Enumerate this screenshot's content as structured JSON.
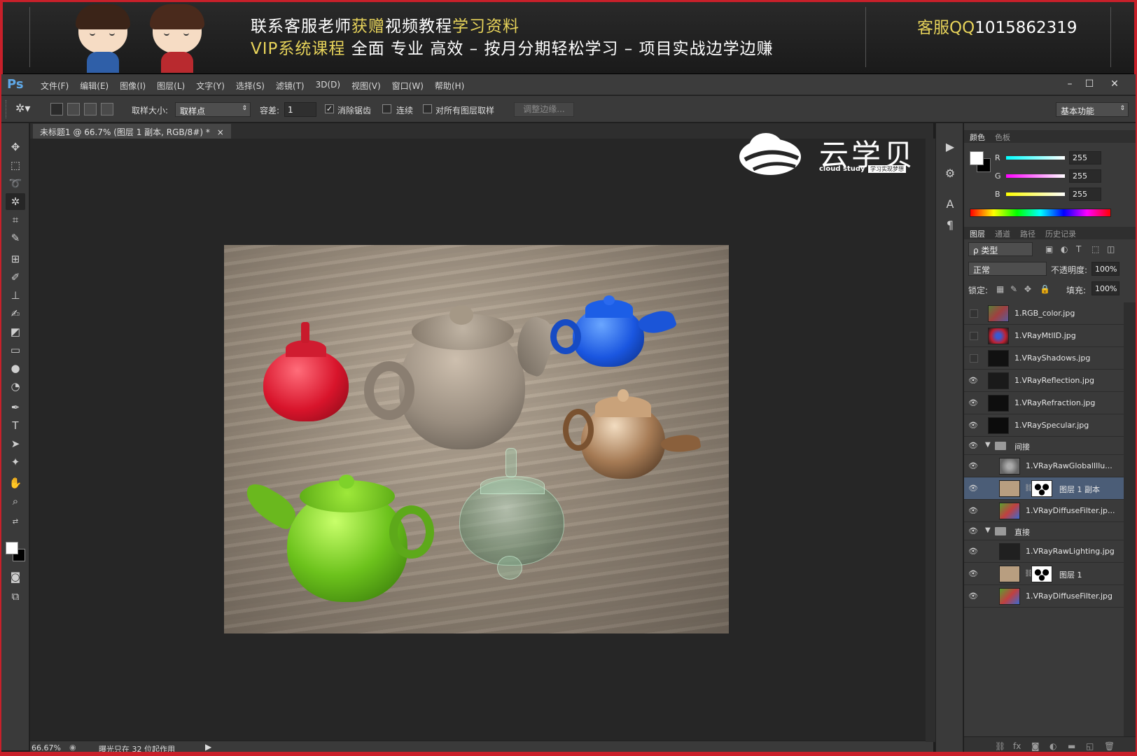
{
  "banner": {
    "line1_a": "联系客服老师",
    "line1_b": "获赠",
    "line1_c": "视频教程",
    "line1_d": "学习资料",
    "line2_a": "VIP系统课程",
    "line2_b": "   全面  专业  高效  –  按月分期轻松学习  –  项目实战边学边赚",
    "qq_label": "客服QQ",
    "qq_number": "1015862319"
  },
  "app": {
    "logo": "Ps",
    "menu": [
      "文件(F)",
      "编辑(E)",
      "图像(I)",
      "图层(L)",
      "文字(Y)",
      "选择(S)",
      "滤镜(T)",
      "3D(D)",
      "视图(V)",
      "窗口(W)",
      "帮助(H)"
    ],
    "window_controls": {
      "minimize": "–",
      "maximize": "☐",
      "close": "✕"
    }
  },
  "options": {
    "sample_size_label": "取样大小:",
    "sample_size_value": "取样点",
    "tolerance_label": "容差:",
    "tolerance_value": "1",
    "anti_alias_label": "消除锯齿",
    "anti_alias_checked": true,
    "contiguous_label": "连续",
    "contiguous_checked": false,
    "sample_all_label": "对所有图层取样",
    "sample_all_checked": false,
    "refine_edge_label": "调整边缘...",
    "workspace_value": "基本功能"
  },
  "document": {
    "tab_title": "未标题1 @ 66.7% (图层 1 副本, RGB/8#) *",
    "tab_close": "×",
    "watermark_text": "云学贝",
    "watermark_sub": "cloud study",
    "watermark_sub2": "学习实现梦想"
  },
  "status": {
    "zoom": "66.67%",
    "message": "曝光只在 32 位起作用",
    "arrow": "▶"
  },
  "color_panel": {
    "tabs": [
      "颜色",
      "色板"
    ],
    "r_label": "R",
    "r_value": "255",
    "g_label": "G",
    "g_value": "255",
    "b_label": "B",
    "b_value": "255"
  },
  "layers_panel": {
    "tabs": [
      "图层",
      "通道",
      "路径",
      "历史记录"
    ],
    "filter_value": "ρ 类型",
    "blend_mode": "正常",
    "opacity_label": "不透明度:",
    "opacity_value": "100%",
    "lock_label": "锁定:",
    "fill_label": "填充:",
    "fill_value": "100%",
    "layers": [
      {
        "name": "1.RGB_color.jpg",
        "visible": false
      },
      {
        "name": "1.VRayMtlID.jpg",
        "visible": false
      },
      {
        "name": "1.VRayShadows.jpg",
        "visible": false
      },
      {
        "name": "1.VRayReflection.jpg",
        "visible": true
      },
      {
        "name": "1.VRayRefraction.jpg",
        "visible": true
      },
      {
        "name": "1.VRaySpecular.jpg",
        "visible": true
      },
      {
        "name": "间接",
        "visible": true,
        "group": true
      },
      {
        "name": "1.VRayRawGlobalIllu...",
        "visible": true
      },
      {
        "name": "图层 1 副本",
        "visible": true,
        "selected": true,
        "masked": true
      },
      {
        "name": "1.VRayDiffuseFilter.jp...",
        "visible": true
      },
      {
        "name": "直接",
        "visible": true,
        "group": true
      },
      {
        "name": "1.VRayRawLighting.jpg",
        "visible": true
      },
      {
        "name": "图层 1",
        "visible": true,
        "masked": true
      },
      {
        "name": "1.VRayDiffuseFilter.jpg",
        "visible": true
      }
    ]
  },
  "colors": {
    "accent_red": "#c8202a",
    "banner_highlight": "#e7d35a",
    "ps_blue": "#5fa8e6",
    "selected_layer": "#4b5d77"
  }
}
